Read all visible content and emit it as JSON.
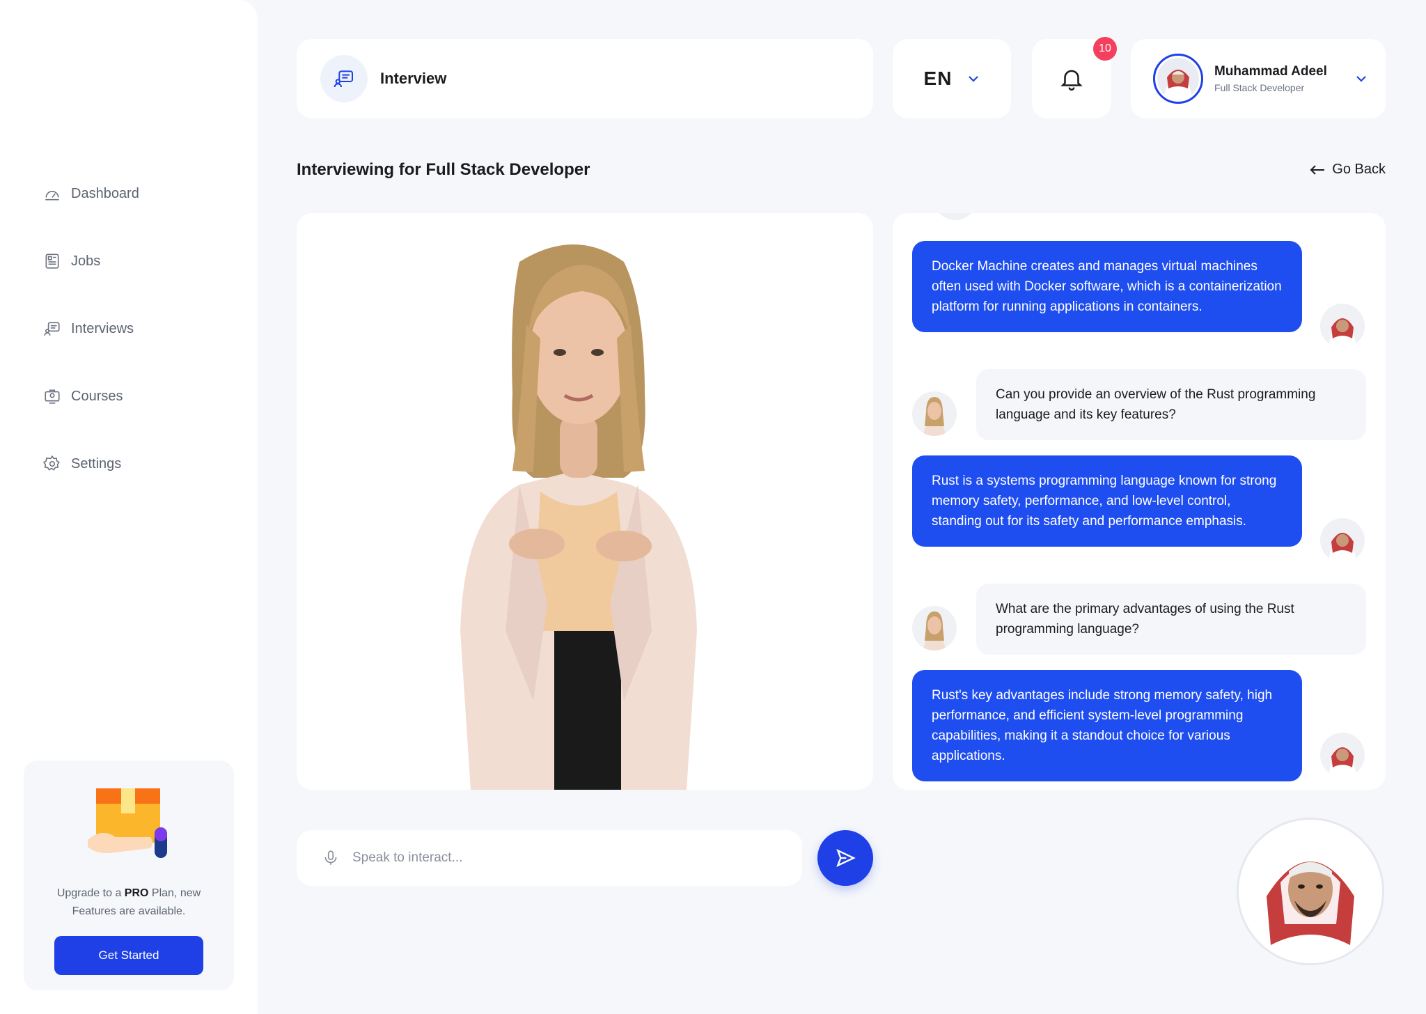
{
  "sidebar": {
    "items": [
      {
        "label": "Dashboard",
        "icon": "dashboard-icon"
      },
      {
        "label": "Jobs",
        "icon": "jobs-icon"
      },
      {
        "label": "Interviews",
        "icon": "interviews-icon"
      },
      {
        "label": "Courses",
        "icon": "courses-icon"
      },
      {
        "label": "Settings",
        "icon": "settings-icon"
      }
    ],
    "promo": {
      "text_before": "Upgrade to a ",
      "text_bold": "PRO",
      "text_after": " Plan, new Features are available.",
      "button_label": "Get Started"
    }
  },
  "header": {
    "title": "Interview",
    "language": "EN",
    "notification_count": "10",
    "user": {
      "name": "Muhammad Adeel",
      "role": "Full Stack Developer"
    }
  },
  "main": {
    "page_title": "Interviewing for Full Stack Developer",
    "go_back_label": "Go Back"
  },
  "chat": {
    "messages": [
      {
        "from": "user",
        "text": "Docker Machine creates and manages virtual machines often used with Docker software, which is a containerization platform for running applications in containers."
      },
      {
        "from": "ai",
        "text": "Can you provide an overview of the Rust programming language and its key features?"
      },
      {
        "from": "user",
        "text": "Rust is a systems programming language known for strong memory safety, performance, and low-level control, standing out for its safety and performance emphasis."
      },
      {
        "from": "ai",
        "text": "What are the primary advantages of using the Rust programming language?"
      },
      {
        "from": "user",
        "text": "Rust's key advantages include strong memory safety, high performance, and efficient system-level programming capabilities, making it a standout choice for various applications."
      }
    ]
  },
  "input": {
    "placeholder": "Speak to interact..."
  },
  "colors": {
    "accent": "#1e40e6",
    "bubble_user": "#1e4df0",
    "badge": "#f43f5e",
    "background": "#f6f7fb"
  }
}
